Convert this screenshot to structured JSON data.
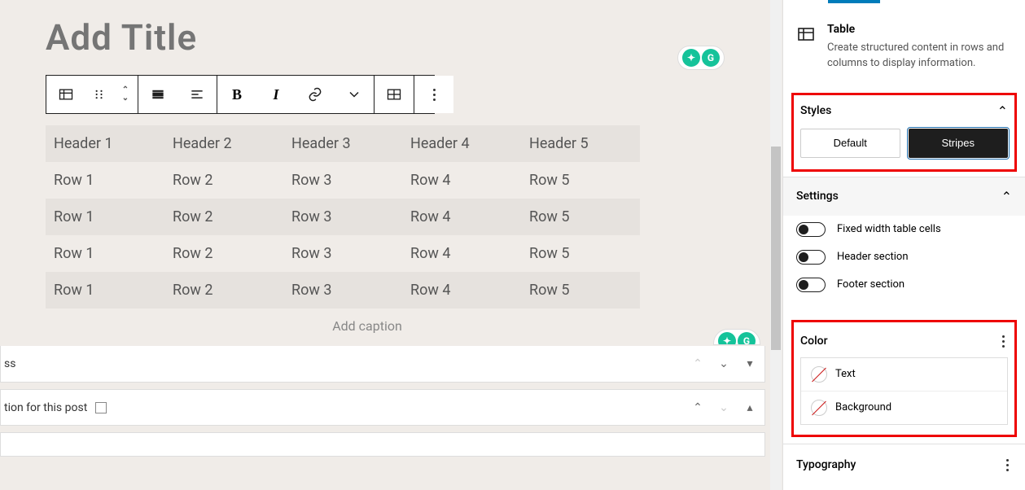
{
  "editor": {
    "title_placeholder": "Add Title",
    "caption_placeholder": "Add caption"
  },
  "table": {
    "headers": [
      "Header 1",
      "Header 2",
      "Header 3",
      "Header 4",
      "Header 5"
    ],
    "rows": [
      [
        "Row 1",
        "Row 2",
        "Row 3",
        "Row 4",
        "Row 5"
      ],
      [
        "Row 1",
        "Row 2",
        "Row 3",
        "Row 4",
        "Row 5"
      ],
      [
        "Row 1",
        "Row 2",
        "Row 3",
        "Row 4",
        "Row 5"
      ],
      [
        "Row 1",
        "Row 2",
        "Row 3",
        "Row 4",
        "Row 5"
      ]
    ]
  },
  "metabox": {
    "row1": "ss",
    "row2": "tion for this post "
  },
  "sidebar": {
    "block": {
      "title": "Table",
      "desc": "Create structured content in rows and columns to display information."
    },
    "styles": {
      "heading": "Styles",
      "default": "Default",
      "stripes": "Stripes"
    },
    "settings": {
      "heading": "Settings",
      "fixed": "Fixed width table cells",
      "header": "Header section",
      "footer": "Footer section"
    },
    "color": {
      "heading": "Color",
      "text": "Text",
      "background": "Background"
    },
    "typography": {
      "heading": "Typography"
    }
  }
}
